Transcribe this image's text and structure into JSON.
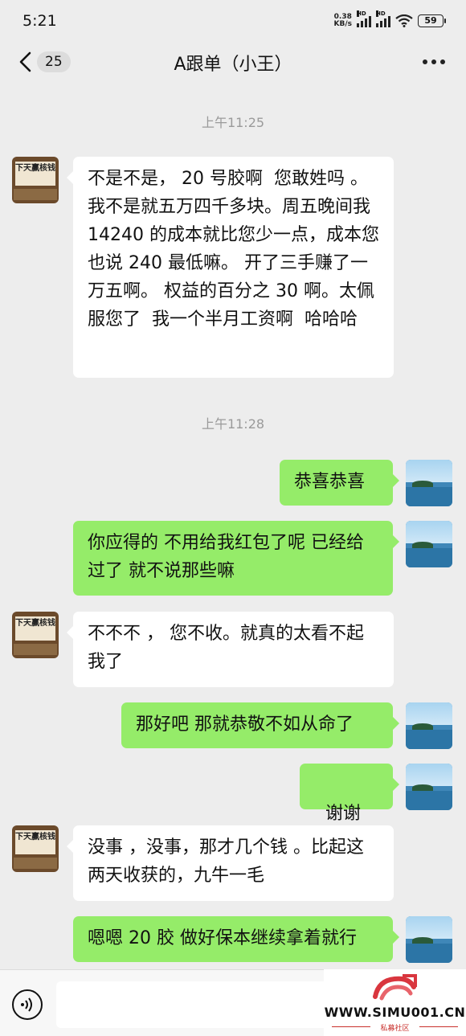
{
  "status_bar": {
    "time": "5:21",
    "net_speed_value": "0.38",
    "net_speed_unit": "KB/s",
    "signal_label": "HD",
    "battery": "59"
  },
  "nav": {
    "unread_count": "25",
    "title": "A跟单（小王）"
  },
  "messages": {
    "t1": "上午11:25",
    "m1": "不是不是， 20 号胶啊  您敢姓吗 。我不是就五万四千多块。周五晚间我 14240 的成本就比您少一点，成本您也说 240 最低嘛。 开了三手赚了一万五啊。 权益的百分之 30 啊。太佩服您了  我一个半月工资啊  哈哈哈",
    "t2": "上午11:28",
    "m2": "恭喜恭喜",
    "m3": "你应得的 不用给我红包了呢 已经给过了 就不说那些嘛",
    "m4": "不不不 ， 您不收。就真的太看不起我了",
    "m5": "那好吧 那就恭敬不如从命了",
    "m6": "谢谢",
    "m7": "没事 ，没事，那才几个钱 。比起这两天收获的，九牛一毛",
    "m8": "嗯嗯 20 胶 做好保本继续拿着就行"
  },
  "avatar": {
    "contact_plaque": "下天赢核钱"
  },
  "watermark": {
    "url": "WWW.SIMU001.CN",
    "sub": "私募社区"
  },
  "icons": {
    "back": "back-chevron-icon",
    "more": "more-dots-icon",
    "voice": "voice-icon",
    "emoji": "ok-hand-emoji-icon",
    "wifi": "wifi-icon",
    "battery": "battery-icon"
  },
  "colors": {
    "background": "#ededed",
    "sent_bubble": "#95ec69",
    "received_bubble": "#ffffff",
    "watermark_accent": "#c9302c"
  }
}
